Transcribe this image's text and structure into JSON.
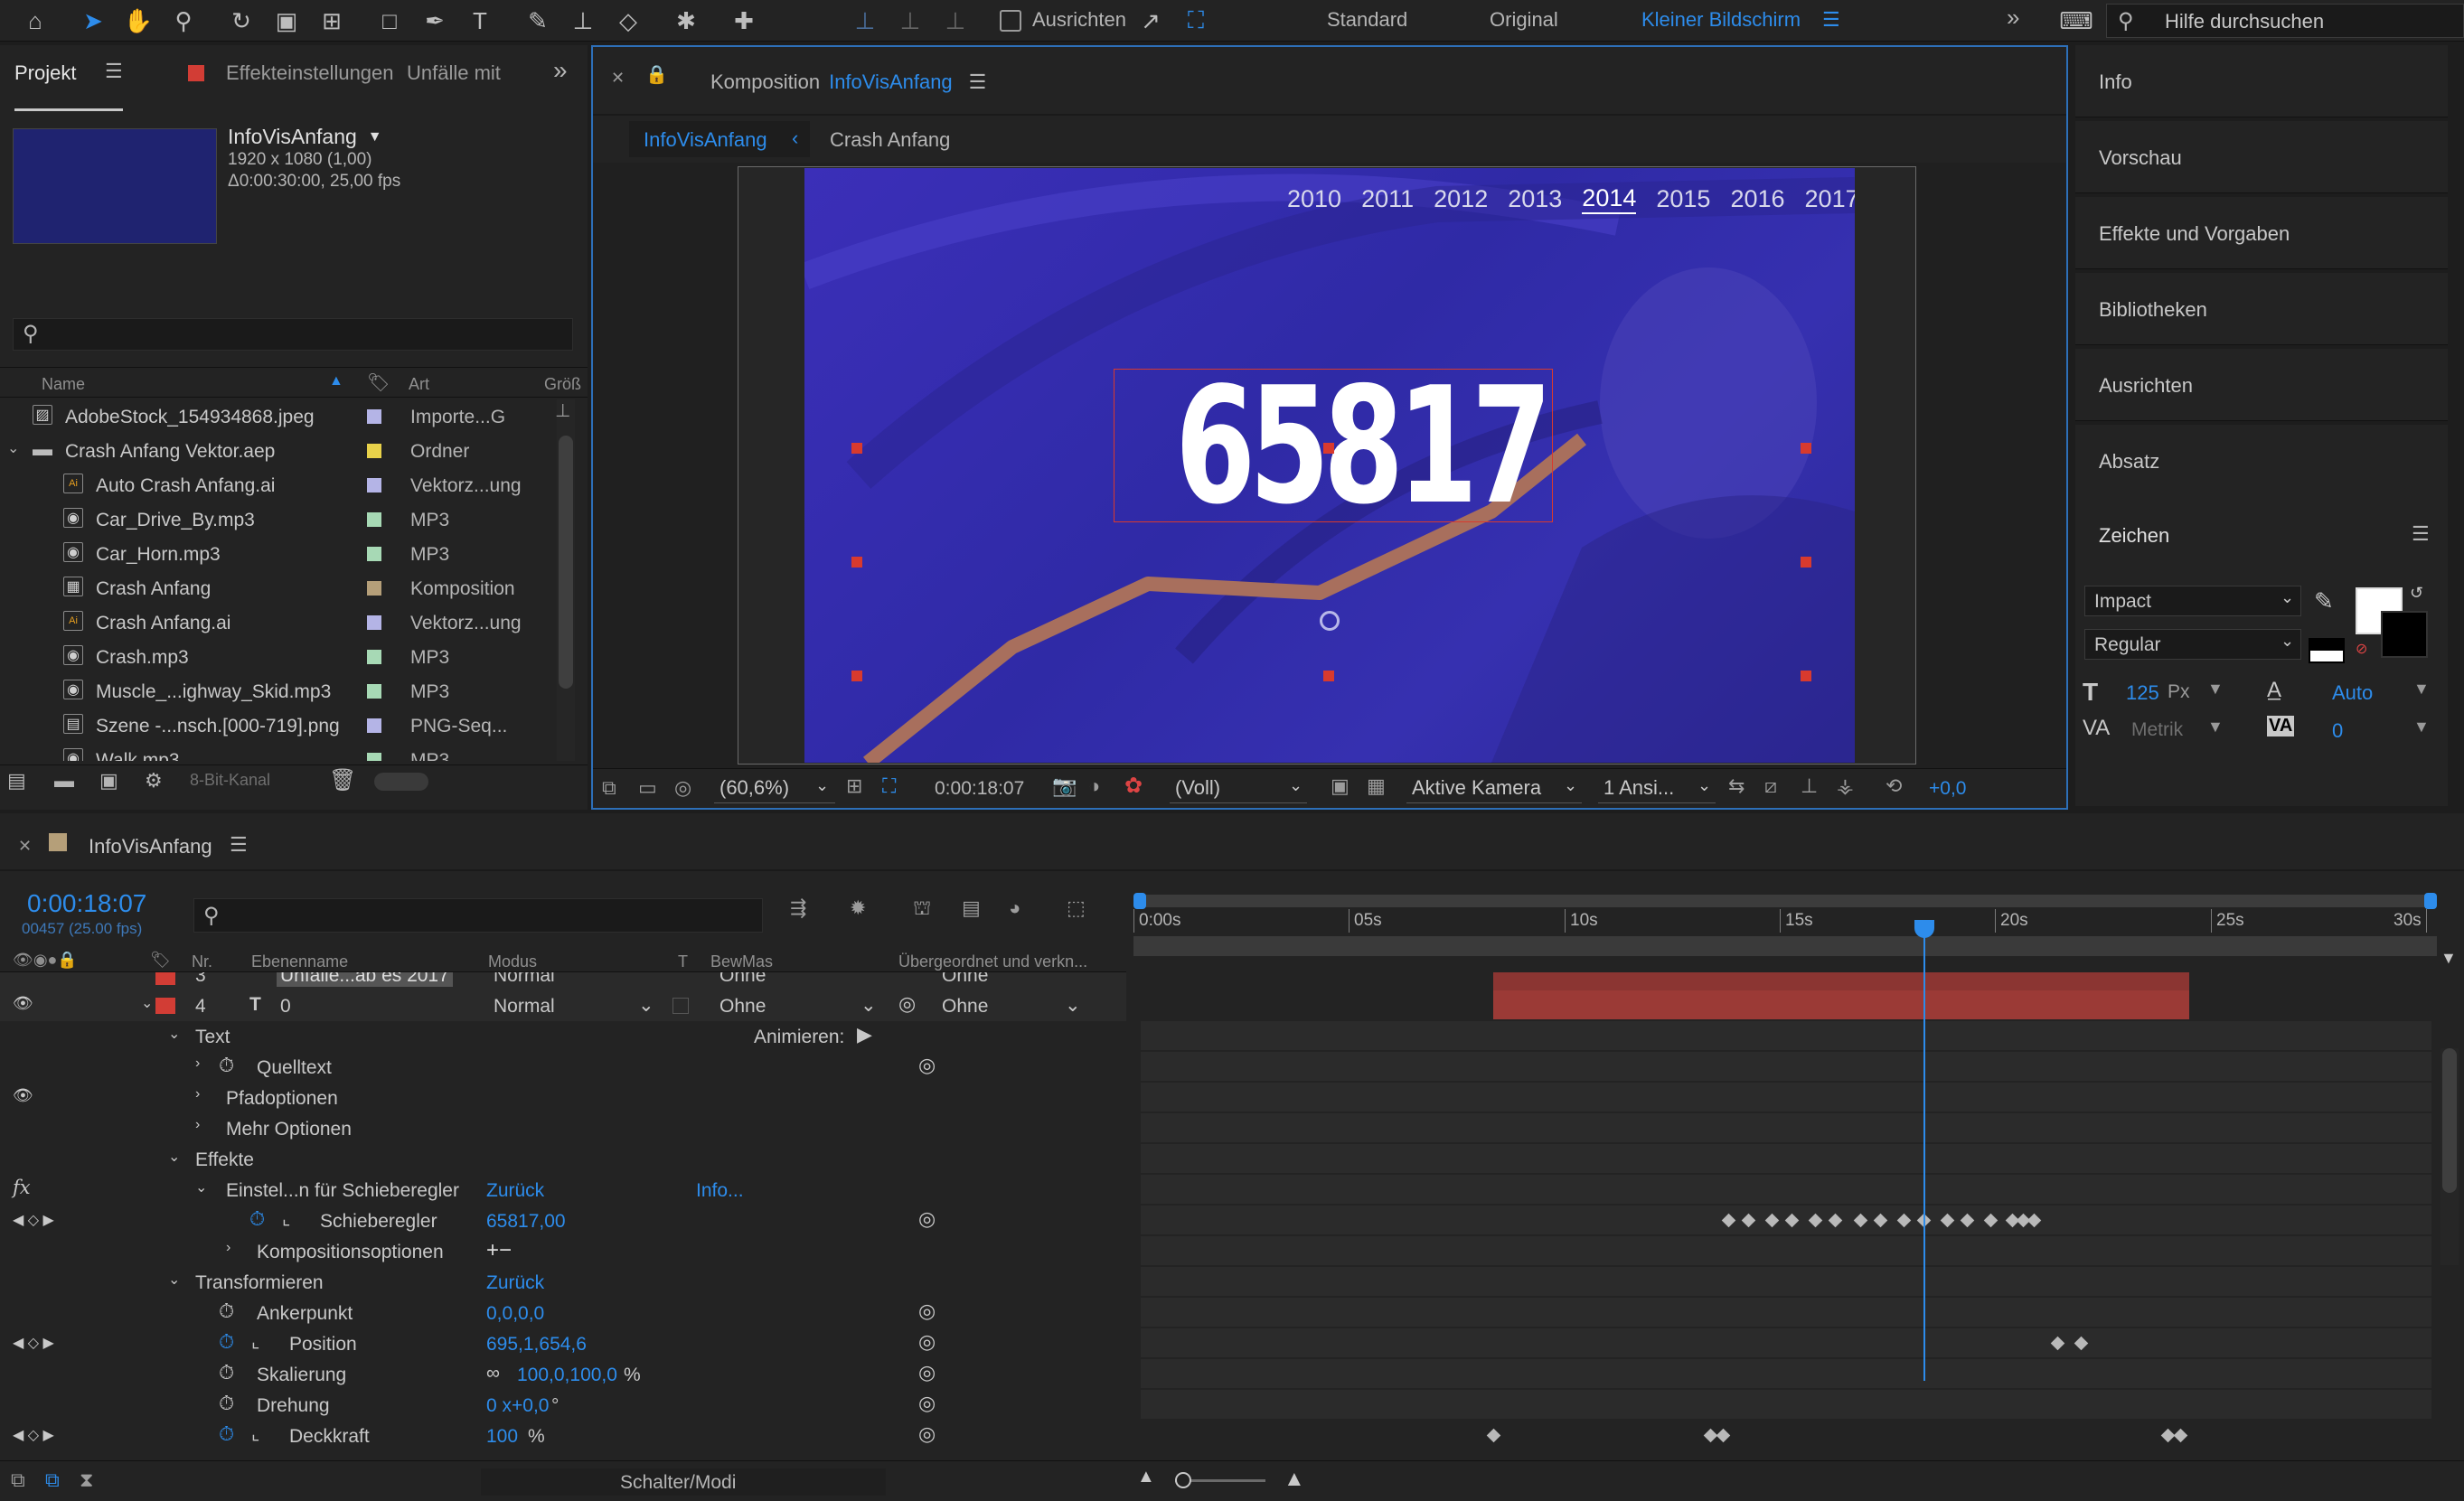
{
  "toolbar": {
    "align_label": "Ausrichten",
    "workspaces": [
      "Standard",
      "Original",
      "Kleiner Bildschirm"
    ],
    "search_placeholder": "Hilfe durchsuchen"
  },
  "project": {
    "tab": "Projekt",
    "effects_tab": "Effekteinstellungen",
    "effects_target": "Unfälle mit",
    "item_name": "InfoVisAnfang",
    "item_size": "1920 x 1080 (1,00)",
    "item_duration": "Δ0:00:30:00, 25,00 fps",
    "col_name": "Name",
    "col_type": "Art",
    "col_size": "Größ",
    "bit_depth": "8-Bit-Kanal",
    "files": [
      {
        "name": "AdobeStock_154934868.jpeg",
        "type": "Importe...G",
        "color": "#b4b4e6",
        "icon": "image-icon",
        "indent": 0
      },
      {
        "name": "Crash Anfang Vektor.aep",
        "type": "Ordner",
        "color": "#e8d24a",
        "icon": "folder-icon",
        "indent": 0
      },
      {
        "name": "Auto Crash Anfang.ai",
        "type": "Vektorz...ung",
        "color": "#b4b4e6",
        "icon": "ai-file-icon",
        "indent": 1
      },
      {
        "name": "Car_Drive_By.mp3",
        "type": "MP3",
        "color": "#a7d9b5",
        "icon": "audio-icon",
        "indent": 1
      },
      {
        "name": "Car_Horn.mp3",
        "type": "MP3",
        "color": "#a7d9b5",
        "icon": "audio-icon",
        "indent": 1
      },
      {
        "name": "Crash Anfang",
        "type": "Komposition",
        "color": "#b59f79",
        "icon": "composition-icon",
        "indent": 1
      },
      {
        "name": "Crash Anfang.ai",
        "type": "Vektorz...ung",
        "color": "#b4b4e6",
        "icon": "ai-file-icon",
        "indent": 1
      },
      {
        "name": "Crash.mp3",
        "type": "MP3",
        "color": "#a7d9b5",
        "icon": "audio-icon",
        "indent": 1
      },
      {
        "name": "Muscle_...ighway_Skid.mp3",
        "type": "MP3",
        "color": "#a7d9b5",
        "icon": "audio-icon",
        "indent": 1
      },
      {
        "name": "Szene -...nsch.[000-719].png",
        "type": "PNG-Seq...",
        "color": "#b4b4e6",
        "icon": "sequence-icon",
        "indent": 1
      },
      {
        "name": "Walk.mp3",
        "type": "MP3",
        "color": "#a7d9b5",
        "icon": "audio-icon",
        "indent": 1
      }
    ]
  },
  "composition": {
    "label": "Komposition",
    "name": "InfoVisAnfang",
    "tabs": [
      "InfoVisAnfang",
      "Crash Anfang"
    ],
    "years": [
      "2010",
      "2011",
      "2012",
      "2013",
      "2014",
      "2015",
      "2016",
      "2017"
    ],
    "active_year": "2014",
    "big_number": "65817",
    "zoom": "(60,6%)",
    "timecode": "0:00:18:07",
    "resolution": "(Voll)",
    "camera": "Aktive Kamera",
    "views": "1 Ansi...",
    "exposure": "+0,0"
  },
  "right_panel": {
    "items": [
      "Info",
      "Vorschau",
      "Effekte und Vorgaben",
      "Bibliotheken",
      "Ausrichten",
      "Absatz"
    ],
    "character": {
      "title": "Zeichen",
      "font": "Impact",
      "style": "Regular",
      "size": "125",
      "size_unit": "Px",
      "leading": "Auto",
      "kerning": "Metrik",
      "tracking": "0"
    }
  },
  "timeline": {
    "tab": "InfoVisAnfang",
    "time": "0:00:18:07",
    "frames": "00457 (25.00 fps)",
    "ruler": [
      "0:00s",
      "05s",
      "10s",
      "15s",
      "20s",
      "25s",
      "30s"
    ],
    "cols": {
      "nr": "Nr.",
      "name": "Ebenenname",
      "mode": "Modus",
      "t": "T",
      "bewmas": "BewMas",
      "parent": "Übergeordnet und verkn..."
    },
    "layer3": {
      "nr": "3",
      "name": "Unfälle...ab es 2017",
      "mode": "Normal",
      "bewmas": "Ohne",
      "parent": "Ohne"
    },
    "layer4": {
      "nr": "4",
      "name": "0",
      "mode": "Normal",
      "bewmas": "Ohne",
      "parent": "Ohne"
    },
    "props": {
      "text": "Text",
      "animate": "Animieren:",
      "source_text": "Quelltext",
      "path_options": "Pfadoptionen",
      "more_options": "Mehr Optionen",
      "effects": "Effekte",
      "slider_control": "Einstel...n für Schieberegler",
      "reset": "Zurück",
      "info": "Info...",
      "slider": "Schieberegler",
      "slider_value": "65817,00",
      "comp_options": "Kompositionsoptionen",
      "transform": "Transformieren",
      "transform_reset": "Zurück",
      "anchor": "Ankerpunkt",
      "anchor_val": "0,0,0,0",
      "position": "Position",
      "position_val": "695,1,654,6",
      "scale": "Skalierung",
      "scale_val": "100,0,100,0",
      "scale_unit": "%",
      "rotation": "Drehung",
      "rotation_val": "0 x+0,0",
      "rotation_unit": "°",
      "opacity": "Deckkraft",
      "opacity_val": "100",
      "opacity_unit": "%"
    },
    "footer": "Schalter/Modi"
  }
}
